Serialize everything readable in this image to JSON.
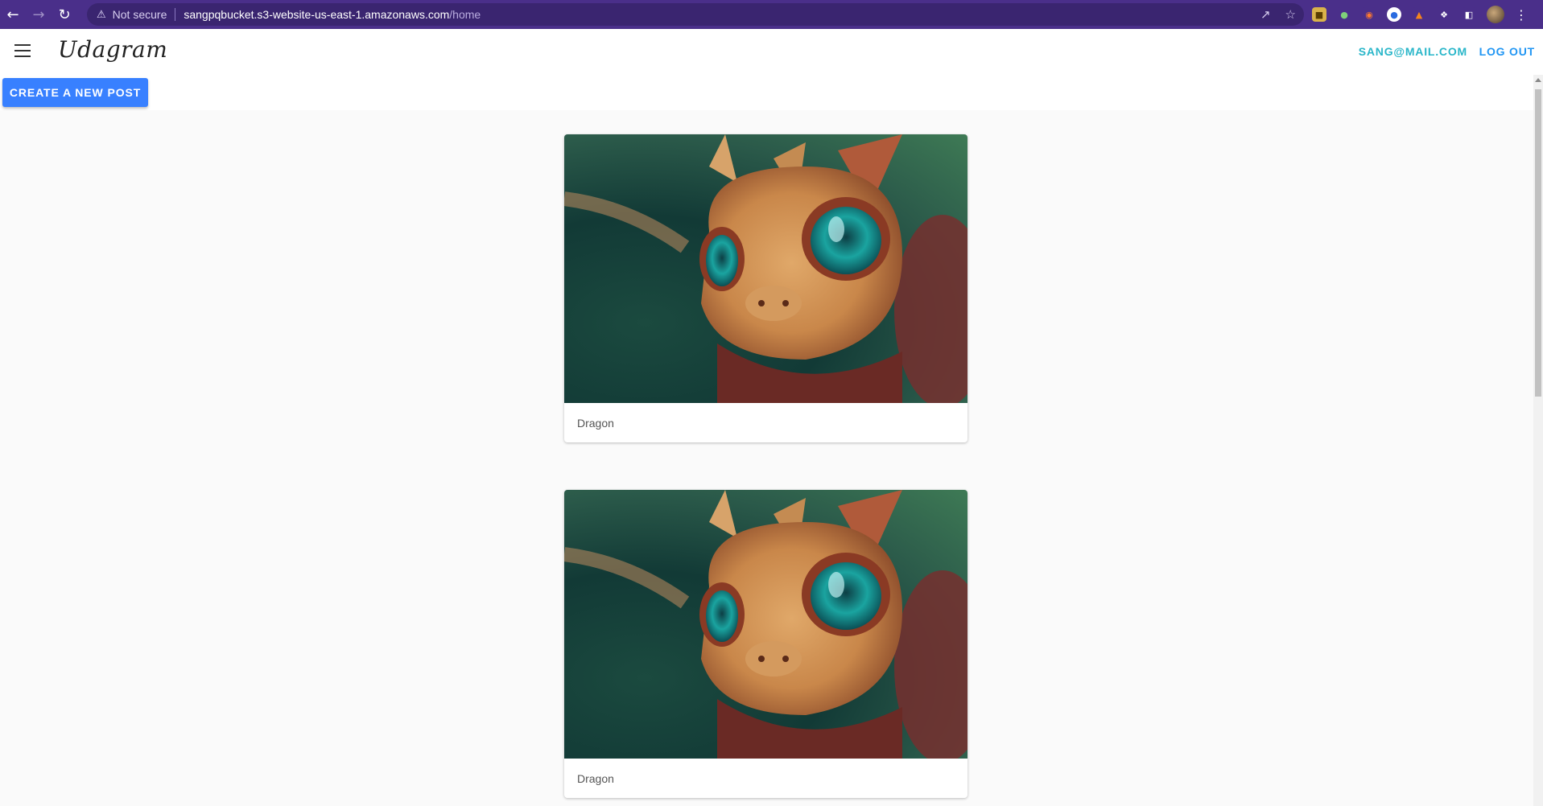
{
  "browser": {
    "not_secure": "Not secure",
    "url_host": "sangpqbucket.s3-website-us-east-1.amazonaws.com",
    "url_path": "/home",
    "icons": [
      "back-arrow-icon",
      "forward-arrow-icon",
      "reload-icon",
      "warning-icon",
      "share-icon",
      "star-icon",
      "extensions-icon",
      "side-panel-icon",
      "menu-dots-icon"
    ]
  },
  "appbar": {
    "brand": "Udagram",
    "user_email": "SANG@MAIL.COM",
    "logout_label": "LOG OUT",
    "accent": "#29b6c9",
    "link_color": "#2196f3"
  },
  "actions": {
    "create_label": "CREATE A NEW POST",
    "button_color": "#3880ff"
  },
  "feed": {
    "posts": [
      {
        "caption": "Dragon"
      },
      {
        "caption": "Dragon"
      }
    ]
  }
}
